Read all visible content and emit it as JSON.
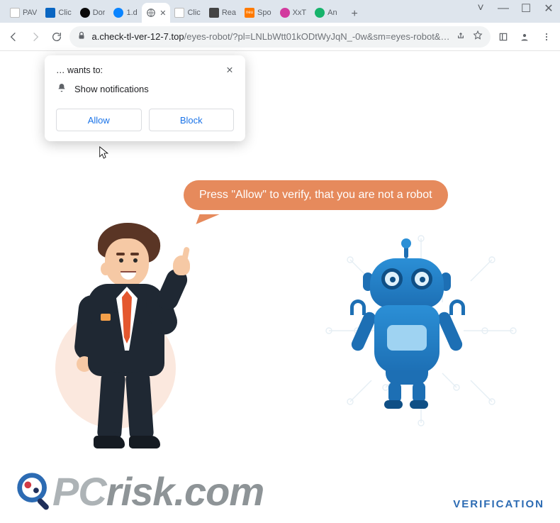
{
  "window": {
    "controls": {
      "chevron": "˅",
      "min": "—",
      "max": "☐",
      "close": "✕"
    }
  },
  "tabs": [
    {
      "label": "PAV",
      "favColor": "#ffffff",
      "favText": "⌂"
    },
    {
      "label": "Clic",
      "favColor": "#0a66c2",
      "favText": ""
    },
    {
      "label": "Dor",
      "favColor": "#0b0b0b",
      "favText": ""
    },
    {
      "label": "1.d",
      "favColor": "#0a84ff",
      "favText": ""
    },
    {
      "label": "",
      "favColor": "#808080",
      "favText": "",
      "active": true,
      "close": "✕"
    },
    {
      "label": "Clic",
      "favColor": "#1a73e8",
      "favText": ""
    },
    {
      "label": "Rea",
      "favColor": "#444444",
      "favText": ""
    },
    {
      "label": "Spo",
      "favColor": "#ff7a00",
      "favText": "neu"
    },
    {
      "label": "XxT",
      "favColor": "#d23a9e",
      "favText": ""
    },
    {
      "label": "An",
      "favColor": "#16b36b",
      "favText": ""
    }
  ],
  "newtab_label": "+",
  "toolbar": {
    "back": "←",
    "forward": "→",
    "reload": "⟳",
    "lock": "lock",
    "url_domain": "a.check-tl-ver-12-7.top",
    "url_path": "/eyes-robot/?pl=LNLbWtt01kODtWyJqN_-0w&sm=eyes-robot&…",
    "share": "share",
    "star": "star",
    "reading": "reading",
    "profile": "profile",
    "menu": "menu"
  },
  "permission": {
    "title": "… wants to:",
    "row": "Show notifications",
    "allow": "Allow",
    "block": "Block",
    "close": "✕",
    "icon": "bell"
  },
  "page": {
    "speech": "Press \"Allow\" to verify, that you are not a robot",
    "verification": "VERIFICATION",
    "logo_main": "PC",
    "logo_rest": "risk.com"
  },
  "colors": {
    "speech_bg": "#e68a5c",
    "perm_action": "#1a73e8",
    "verification_text": "#2c6bb3"
  }
}
